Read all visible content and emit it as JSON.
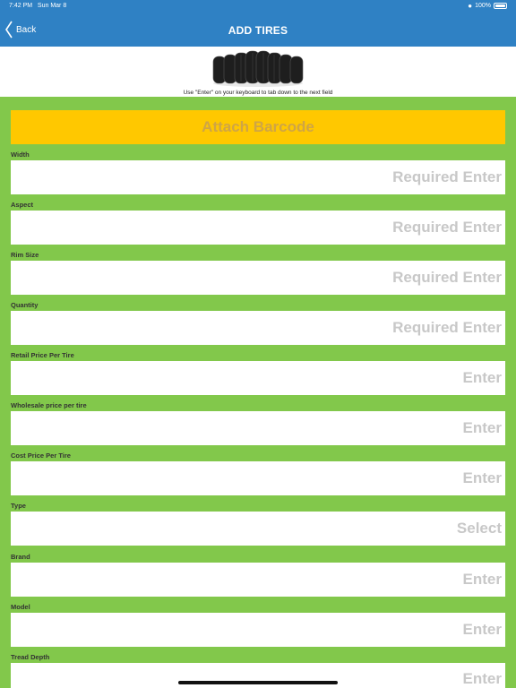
{
  "status_bar": {
    "time": "7:42 PM",
    "date": "Sun Mar 8",
    "battery": "100%"
  },
  "nav": {
    "back_label": "Back",
    "title": "ADD TIRES"
  },
  "header": {
    "image_icon": "tire-stack-icon",
    "hint": "Use \"Enter\" on your keyboard to tab down to the next field"
  },
  "barcode_button": {
    "label": "Attach Barcode"
  },
  "fields": [
    {
      "label": "Width",
      "placeholder": "Required Enter"
    },
    {
      "label": "Aspect",
      "placeholder": "Required Enter"
    },
    {
      "label": "Rim Size",
      "placeholder": "Required Enter"
    },
    {
      "label": "Quantity",
      "placeholder": "Required Enter"
    },
    {
      "label": "Retail Price Per Tire",
      "placeholder": "Enter"
    },
    {
      "label": "Wholesale price per tire",
      "placeholder": "Enter"
    },
    {
      "label": "Cost Price Per Tire",
      "placeholder": "Enter"
    },
    {
      "label": "Type",
      "placeholder": "Select"
    },
    {
      "label": "Brand",
      "placeholder": "Enter"
    },
    {
      "label": "Model",
      "placeholder": "Enter"
    },
    {
      "label": "Tread Depth",
      "placeholder": "Enter"
    }
  ],
  "colors": {
    "nav": "#2f81c4",
    "background": "#82c84b",
    "barcode": "#ffc800",
    "barcode_text": "#cfa545",
    "placeholder": "#c8c8c8"
  }
}
